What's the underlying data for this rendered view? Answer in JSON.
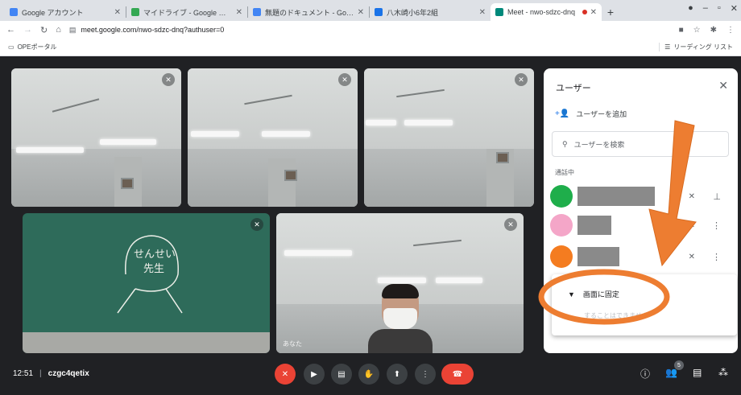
{
  "browser": {
    "tabs": [
      {
        "label": "Google アカウント",
        "color": "#4285f4"
      },
      {
        "label": "マイドライブ - Google ドラ",
        "color": "#34a853"
      },
      {
        "label": "無題のドキュメント - Goog",
        "color": "#4285f4"
      },
      {
        "label": "八木崎小6年2組",
        "color": "#1a73e8"
      },
      {
        "label": "Meet - nwo-sdzc-dnq",
        "color": "#00897b"
      }
    ],
    "url": "meet.google.com/nwo-sdzc-dnq?authuser=0",
    "bookmark": "OPEポータル",
    "reading_list": "リーディング リスト"
  },
  "tiles": {
    "top_names": [
      "",
      "",
      ""
    ],
    "teacher_name": "",
    "self_name": "あなた",
    "chalk_line1": "せんせい",
    "chalk_line2": "先生"
  },
  "panel": {
    "title": "ユーザー",
    "add_user": "ユーザーを追加",
    "search_placeholder": "ユーザーを検索",
    "section": "通話中",
    "participants": [
      {
        "avatar_color": "#1fae4b"
      },
      {
        "avatar_color": "#f4a6c8"
      },
      {
        "avatar_color": "#f47c20"
      }
    ],
    "popup_item": "画面に固定",
    "popup_sub": "することはできません"
  },
  "bottom": {
    "time": "12:51",
    "meeting_code": "czgc4qetix",
    "participant_count": "5"
  },
  "annotation": {
    "arrow_color": "#ed7d31",
    "ellipse_color": "#ed7d31"
  }
}
